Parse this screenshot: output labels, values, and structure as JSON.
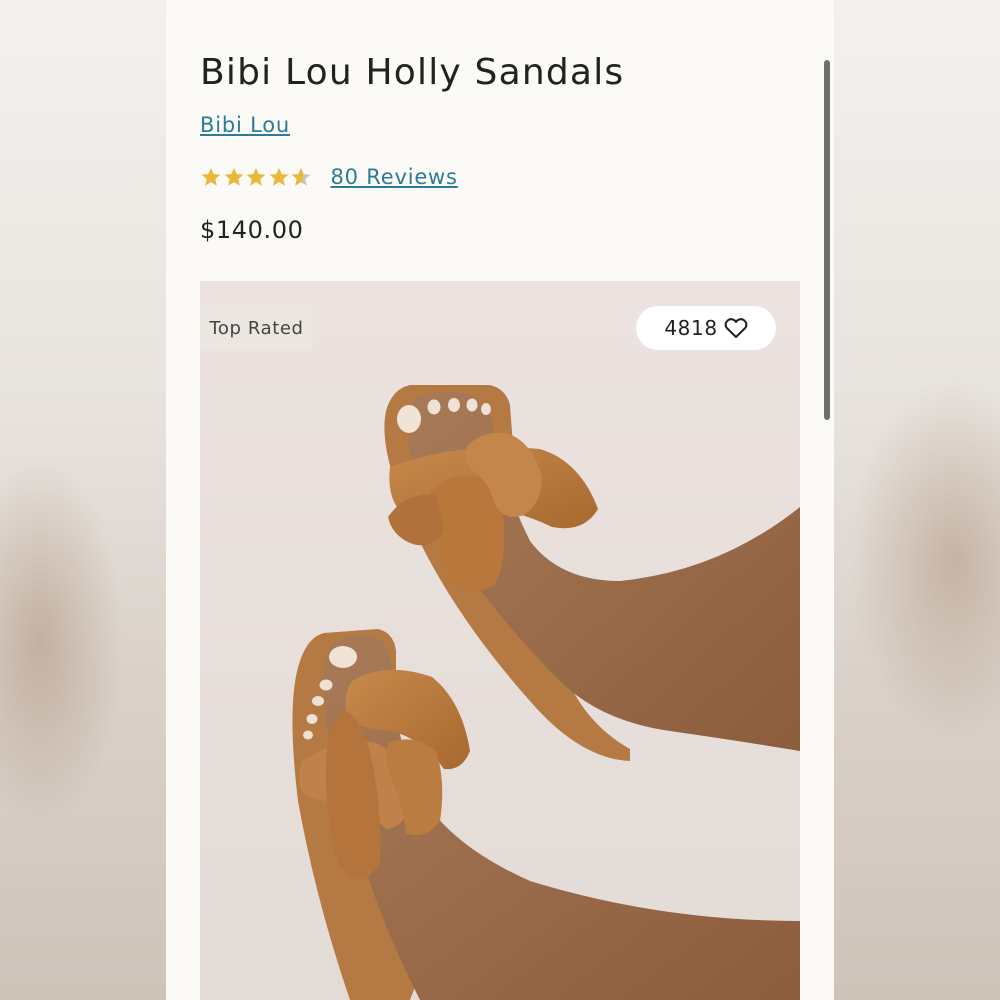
{
  "product": {
    "title": "Bibi Lou Holly Sandals",
    "brand": "Bibi Lou",
    "rating": 4.6,
    "rating_max": 5,
    "reviews_label": "80 Reviews",
    "price": "$140.00"
  },
  "hero": {
    "badge": "Top Rated",
    "likes_count": "4818",
    "like_icon": "heart-outline-icon"
  },
  "colors": {
    "link": "#2c7b97",
    "star": "#e8b93a",
    "star_empty": "#c9c6c2",
    "page_bg": "#fbfaf7",
    "text": "#222222"
  }
}
